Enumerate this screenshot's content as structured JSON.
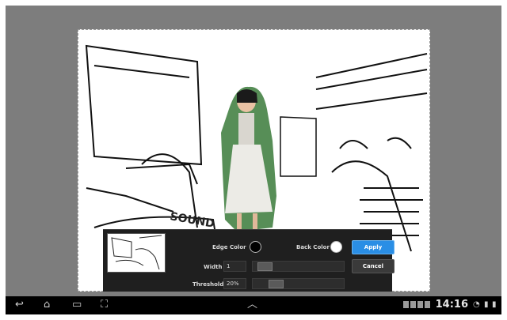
{
  "editor": {
    "edge_color_label": "Edge Color",
    "back_color_label": "Back Color",
    "edge_color": "#000000",
    "back_color": "#ffffff",
    "width_label": "Width",
    "width_value": "1",
    "width_level": 0.05,
    "threshold_label": "Threshold",
    "threshold_value": "20%",
    "threshold_level": 0.2,
    "apply_label": "Apply",
    "cancel_label": "Cancel"
  },
  "statusbar": {
    "time": "14:16"
  },
  "colors": {
    "accent": "#2a8ee5",
    "panel_bg": "#1f1f1f",
    "navbar_bg": "#000000"
  },
  "icons": [
    "back-icon",
    "home-icon",
    "recent-apps-icon",
    "screenshot-icon",
    "up-chevron-icon",
    "wifi-icon",
    "battery-icon",
    "signal-icon"
  ]
}
